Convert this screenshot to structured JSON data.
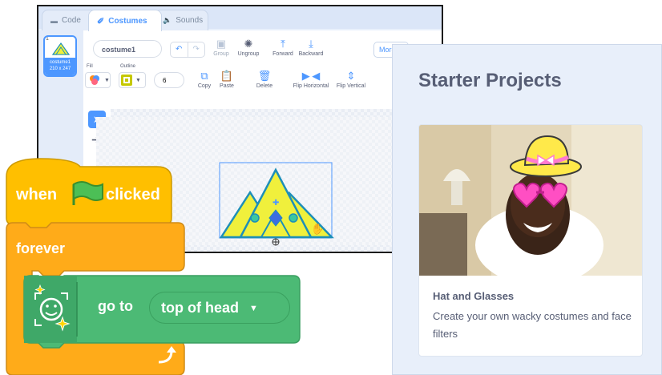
{
  "editor": {
    "tabs": [
      {
        "label": "Code",
        "icon": "code-blocks-icon"
      },
      {
        "label": "Costumes",
        "icon": "paintbrush-icon"
      },
      {
        "label": "Sounds",
        "icon": "speaker-icon"
      }
    ],
    "costume_list": [
      {
        "number": "1",
        "name": "costume1",
        "size": "210 x 247"
      }
    ],
    "costume_name": "costume1",
    "tools": {
      "group": "Group",
      "ungroup": "Ungroup",
      "forward": "Forward",
      "backward": "Backward",
      "more": "More",
      "copy": "Copy",
      "paste": "Paste",
      "delete": "Delete",
      "flip_horizontal": "Flip Horizontal",
      "flip_vertical": "Flip Vertical"
    },
    "fill_label": "Fill",
    "outline_label": "Outline",
    "outline_width": "6",
    "colors": {
      "accent": "#4d97ff",
      "outline": "#c5c800",
      "shape_fill": "#f0f03c",
      "shape_stroke": "#1e8fb8"
    }
  },
  "starter": {
    "heading": "Starter Projects",
    "card_title": "Hat and Glasses",
    "card_description": "Create your own wacky costumes and face filters"
  },
  "blocks": {
    "hat_block": {
      "text_when": "when",
      "text_clicked": "clicked",
      "icon": "green-flag-icon",
      "color": "#ffbf00"
    },
    "forever_block": {
      "label": "forever",
      "color": "#ffab19"
    },
    "goto_block": {
      "label": "go to",
      "dropdown_value": "top of head",
      "icon": "face-sensing-icon",
      "color": "#0fbd8c"
    }
  }
}
